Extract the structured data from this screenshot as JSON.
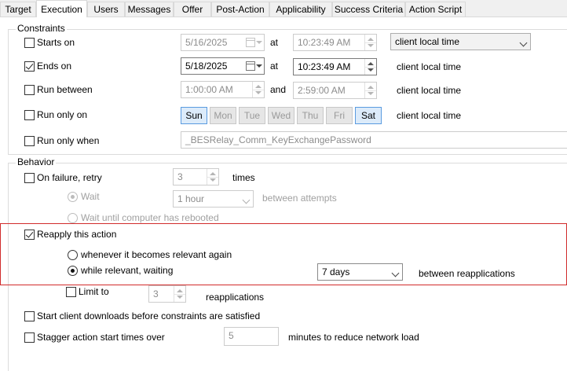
{
  "tabs": [
    {
      "label": "Target"
    },
    {
      "label": "Execution"
    },
    {
      "label": "Users"
    },
    {
      "label": "Messages"
    },
    {
      "label": "Offer"
    },
    {
      "label": "Post-Action"
    },
    {
      "label": "Applicability"
    },
    {
      "label": "Success Criteria"
    },
    {
      "label": "Action Script"
    }
  ],
  "active_tab": "Execution",
  "constraints": {
    "title": "Constraints",
    "starts_on": {
      "label": "Starts on",
      "checked": false,
      "date": "5/16/2025",
      "at_label": "at",
      "time": "10:23:49 AM",
      "timezone": "client local time"
    },
    "ends_on": {
      "label": "Ends on",
      "checked": true,
      "date": "5/18/2025",
      "at_label": "at",
      "time": "10:23:49 AM",
      "timezone": "client local time"
    },
    "run_between": {
      "label": "Run between",
      "checked": false,
      "from": "1:00:00 AM",
      "and_label": "and",
      "to": "2:59:00 AM",
      "timezone": "client local time"
    },
    "run_only_on": {
      "label": "Run only on",
      "checked": false,
      "days": [
        "Sun",
        "Mon",
        "Tue",
        "Wed",
        "Thu",
        "Fri",
        "Sat"
      ],
      "selected_days": [
        "Sun",
        "Sat"
      ],
      "timezone": "client local time"
    },
    "run_only_when": {
      "label": "Run only when",
      "checked": false,
      "value": "_BESRelay_Comm_KeyExchangePassword"
    }
  },
  "behavior": {
    "title": "Behavior",
    "on_failure": {
      "label": "On failure, retry",
      "checked": false,
      "count": "3",
      "times_label": "times",
      "wait_label": "Wait",
      "wait_value": "1 hour",
      "between_attempts": "between attempts",
      "wait_reboot_label": "Wait until computer has rebooted"
    },
    "reapply": {
      "label": "Reapply this action",
      "checked": true,
      "option_relevant": "whenever it becomes relevant again",
      "option_waiting": "while relevant, waiting",
      "selected": "while relevant, waiting",
      "interval": "7 days",
      "between_label": "between reapplications"
    },
    "limit_to": {
      "label": "Limit to",
      "checked": false,
      "count": "3",
      "suffix": "reapplications"
    },
    "start_downloads": {
      "label": "Start client downloads before constraints are satisfied",
      "checked": false
    },
    "stagger": {
      "label": "Stagger action start times over",
      "checked": false,
      "minutes": "5",
      "suffix": "minutes to reduce network load"
    }
  },
  "colors": {
    "highlight": "#d12b2b",
    "day_selected": "#dcebfa"
  }
}
